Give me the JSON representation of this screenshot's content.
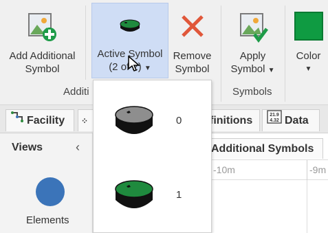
{
  "ribbon": {
    "add_additional": {
      "line1": "Add Additional",
      "line2": "Symbol"
    },
    "active_symbol": {
      "line1": "Active Symbol",
      "line2": "(2 of 2)"
    },
    "remove_symbol": {
      "line1": "Remove",
      "line2": "Symbol"
    },
    "apply_symbol": {
      "line1": "Apply",
      "line2": "Symbol"
    },
    "color": {
      "line1": "Color"
    },
    "group_additional": "Additi",
    "group_symbols": "Symbols",
    "color_swatch": "#0f9b42"
  },
  "tabs": {
    "facility": "Facility",
    "definitions": "finitions",
    "data": "Data",
    "data_icon_text": "21.9\n4.32"
  },
  "views": {
    "title": "Views",
    "elements_label": "Elements"
  },
  "canvas": {
    "tab_label": "Additional Symbols",
    "ruler_labels": [
      "-10m",
      "-9m"
    ]
  },
  "dropdown": {
    "items": [
      {
        "label": "0",
        "top_color": "#8e8e8e"
      },
      {
        "label": "1",
        "top_color": "#1f8a3e"
      }
    ]
  }
}
